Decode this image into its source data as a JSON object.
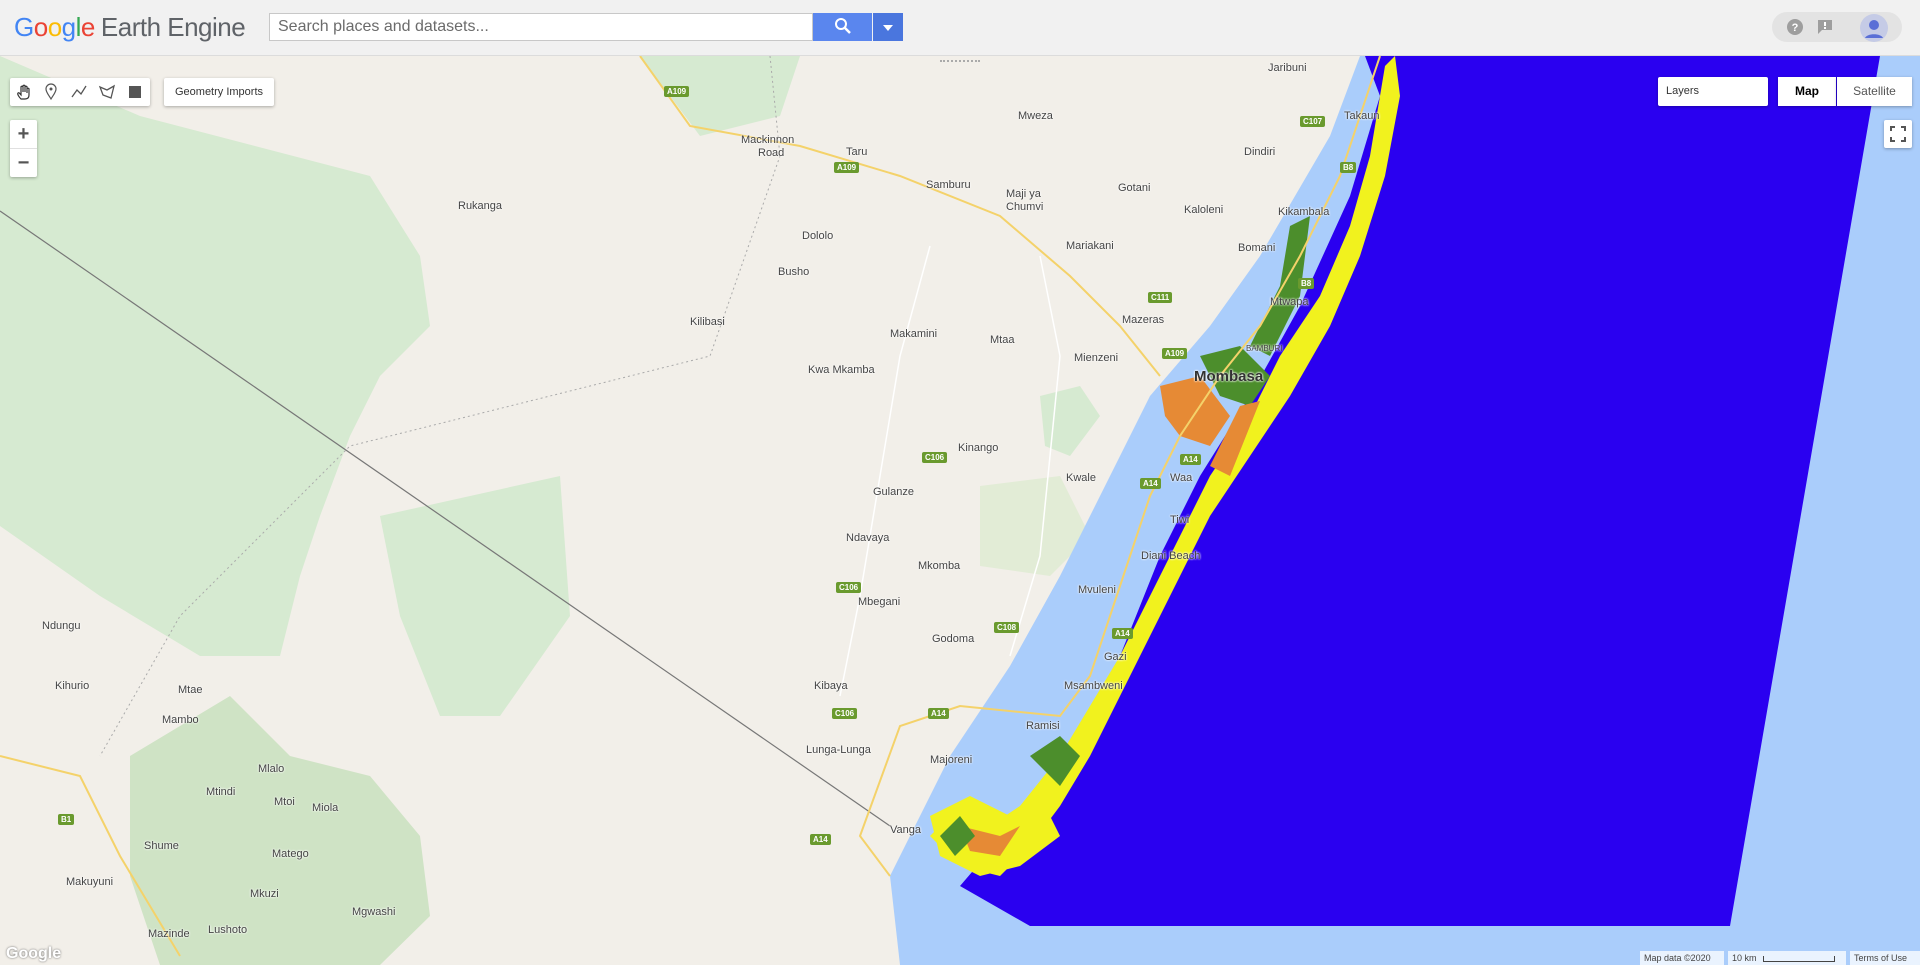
{
  "header": {
    "brand_google": [
      "G",
      "o",
      "o",
      "g",
      "l",
      "e"
    ],
    "brand_product": "Earth Engine",
    "search_placeholder": "Search places and datasets...",
    "icons": [
      "search-icon",
      "chevron-down-icon",
      "help-icon",
      "feedback-icon",
      "account-icon"
    ]
  },
  "map_controls": {
    "drawing_tools": [
      "pan-hand-icon",
      "marker-icon",
      "line-icon",
      "polygon-icon",
      "rectangle-icon"
    ],
    "geometry_imports": "Geometry Imports",
    "zoom_in": "+",
    "zoom_out": "−",
    "layers_label": "Layers",
    "map_type_map": "Map",
    "map_type_satellite": "Satellite",
    "map_type_selected": "Map"
  },
  "places": [
    {
      "name": "Jaribuni"
    },
    {
      "name": "Mweza"
    },
    {
      "name": "Takaun"
    },
    {
      "name": "Mackinnon"
    },
    {
      "name": "Road"
    },
    {
      "name": "Taru"
    },
    {
      "name": "Dindiri"
    },
    {
      "name": "Samburu"
    },
    {
      "name": "Gotani"
    },
    {
      "name": "Maji ya"
    },
    {
      "name": "Chumvi"
    },
    {
      "name": "Rukanga"
    },
    {
      "name": "Kaloleni"
    },
    {
      "name": "Kikambala"
    },
    {
      "name": "Dololo"
    },
    {
      "name": "Mariakani"
    },
    {
      "name": "Bomani"
    },
    {
      "name": "Busho"
    },
    {
      "name": "Mtwapa"
    },
    {
      "name": "Kilibasi"
    },
    {
      "name": "Mazeras"
    },
    {
      "name": "Makamini"
    },
    {
      "name": "Mtaa"
    },
    {
      "name": "BAMBURI"
    },
    {
      "name": "Mienzeni"
    },
    {
      "name": "Kwa Mkamba"
    },
    {
      "name": "Mombasa"
    },
    {
      "name": "Kinango"
    },
    {
      "name": "Kwale"
    },
    {
      "name": "Waa"
    },
    {
      "name": "Gulanze"
    },
    {
      "name": "Tiwi"
    },
    {
      "name": "Ndavaya"
    },
    {
      "name": "Diani Beach"
    },
    {
      "name": "Mkomba"
    },
    {
      "name": "Mvuleni"
    },
    {
      "name": "Mbegani"
    },
    {
      "name": "Ndungu"
    },
    {
      "name": "Godoma"
    },
    {
      "name": "Gazi"
    },
    {
      "name": "Kihurio"
    },
    {
      "name": "Mtae"
    },
    {
      "name": "Kibaya"
    },
    {
      "name": "Msambweni"
    },
    {
      "name": "Mambo"
    },
    {
      "name": "Ramisi"
    },
    {
      "name": "Lunga-Lunga"
    },
    {
      "name": "Mlalo"
    },
    {
      "name": "Majoreni"
    },
    {
      "name": "Mtindi"
    },
    {
      "name": "Mtoi"
    },
    {
      "name": "Miola"
    },
    {
      "name": "Vanga"
    },
    {
      "name": "Shume"
    },
    {
      "name": "Matego"
    },
    {
      "name": "Makuyuni"
    },
    {
      "name": "Mkuzi"
    },
    {
      "name": "Mgwashi"
    },
    {
      "name": "Mazinde"
    },
    {
      "name": "Lushoto"
    }
  ],
  "roads": [
    "A109",
    "A109",
    "C107",
    "B8",
    "B8",
    "C111",
    "A109",
    "A14",
    "C106",
    "A14",
    "C106",
    "C108",
    "A14",
    "C106",
    "A14",
    "B1",
    "A14"
  ],
  "attribution": {
    "logo": "Google",
    "map_data": "Map data ©2020",
    "scale": "10 km",
    "terms": "Terms of Use"
  },
  "colors": {
    "water_class": "#2a00f0",
    "sea": "#aacdfb",
    "land": "#f2efe9",
    "park": "#d6ead1",
    "mangrove_yellow": "#f1f21e",
    "mangrove_green": "#4c8e2c",
    "mangrove_orange": "#e68a35",
    "search_button": "#5a86ee"
  }
}
